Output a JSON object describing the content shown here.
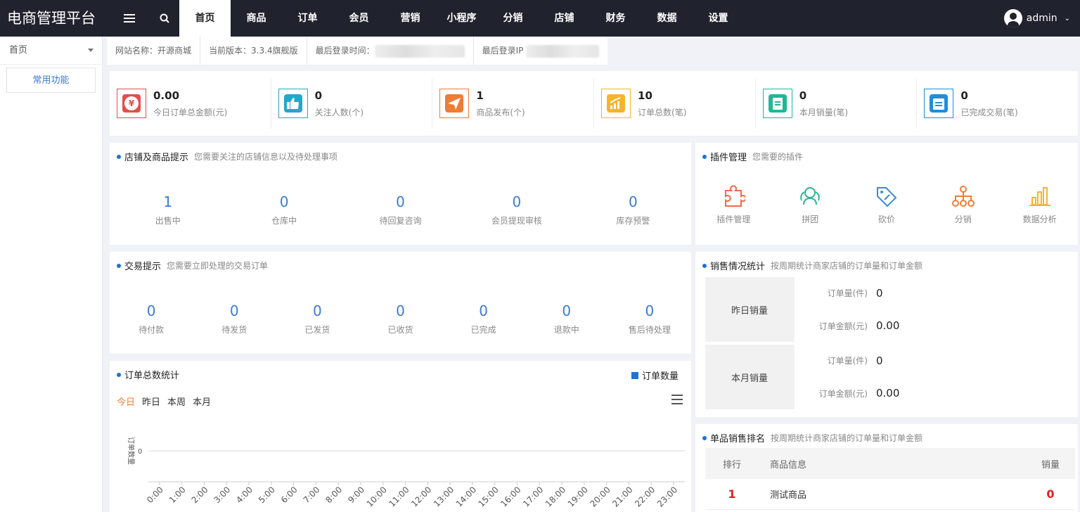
{
  "header": {
    "brand": "电商管理平台",
    "nav": [
      "首页",
      "商品",
      "订单",
      "会员",
      "营销",
      "小程序",
      "分销",
      "店铺",
      "财务",
      "数据",
      "设置"
    ],
    "active_nav": "首页",
    "user": "admin"
  },
  "sidebar": {
    "head": "首页",
    "items": [
      "常用功能"
    ]
  },
  "infobar": {
    "site_name": "网站名称：开源商城",
    "version": "当前版本：3.3.4旗舰版",
    "last_login_time": "最后登录时间：",
    "last_login_ip": "最后登录IP"
  },
  "stats": [
    {
      "value": "0.00",
      "label": "今日订单总金额(元)",
      "icon": "yen-icon",
      "color": "#e0504c"
    },
    {
      "value": "0",
      "label": "关注人数(个)",
      "icon": "thumbs-up-icon",
      "color": "#22a9c9"
    },
    {
      "value": "1",
      "label": "商品发布(个)",
      "icon": "paper-plane-icon",
      "color": "#ef7d35"
    },
    {
      "value": "10",
      "label": "订单总数(笔)",
      "icon": "chart-up-icon",
      "color": "#f5b52a"
    },
    {
      "value": "0",
      "label": "本月销量(笔)",
      "icon": "clipboard-icon",
      "color": "#1eb896"
    },
    {
      "value": "0",
      "label": "已完成交易(笔)",
      "icon": "calendar-icon",
      "color": "#1e8fd8"
    }
  ],
  "shop_panel": {
    "title": "店铺及商品提示",
    "subtitle": "您需要关注的店铺信息以及待处理事项",
    "items": [
      {
        "value": "1",
        "label": "出售中"
      },
      {
        "value": "0",
        "label": "仓库中"
      },
      {
        "value": "0",
        "label": "待回复咨询"
      },
      {
        "value": "0",
        "label": "会员提现审核"
      },
      {
        "value": "0",
        "label": "库存预警"
      }
    ]
  },
  "trade_panel": {
    "title": "交易提示",
    "subtitle": "您需要立即处理的交易订单",
    "items": [
      {
        "value": "0",
        "label": "待付款"
      },
      {
        "value": "0",
        "label": "待发货"
      },
      {
        "value": "0",
        "label": "已发货"
      },
      {
        "value": "0",
        "label": "已收货"
      },
      {
        "value": "0",
        "label": "已完成"
      },
      {
        "value": "0",
        "label": "退款中"
      },
      {
        "value": "0",
        "label": "售后待处理"
      }
    ]
  },
  "plugin_panel": {
    "title": "插件管理",
    "subtitle": "您需要的插件",
    "items": [
      {
        "label": "插件管理",
        "icon": "puzzle-icon",
        "color": "#ef6a4a"
      },
      {
        "label": "拼团",
        "icon": "group-icon",
        "color": "#2bb39a"
      },
      {
        "label": "砍价",
        "icon": "tag-icon",
        "color": "#3a8ad8"
      },
      {
        "label": "分销",
        "icon": "org-tree-icon",
        "color": "#ef7d35"
      },
      {
        "label": "数据分析",
        "icon": "bar-chart-icon",
        "color": "#f5b52a"
      }
    ]
  },
  "sales_panel": {
    "title": "销售情况统计",
    "subtitle": "按周期统计商家店铺的订单量和订单金额",
    "blocks": [
      {
        "name": "昨日销量",
        "rows": [
          {
            "k": "订单量(件)",
            "v": "0"
          },
          {
            "k": "订单金额(元)",
            "v": "0.00"
          }
        ]
      },
      {
        "name": "本月销量",
        "rows": [
          {
            "k": "订单量(件)",
            "v": "0"
          },
          {
            "k": "订单金额(元)",
            "v": "0.00"
          }
        ]
      }
    ]
  },
  "rank_panel": {
    "title": "单品销售排名",
    "subtitle": "按周期统计商家店铺的订单量和订单金额",
    "headers": [
      "排行",
      "商品信息",
      "销量"
    ],
    "rows": [
      {
        "rank": "1",
        "name": "测试商品",
        "sales": "0"
      }
    ]
  },
  "order_chart_panel": {
    "title": "订单总数统计",
    "tabs": [
      "今日",
      "昨日",
      "本周",
      "本月"
    ],
    "active_tab": "今日",
    "accent": "#ef7d35",
    "legend": "订单数量"
  },
  "chart_data": {
    "type": "bar",
    "categories": [
      "0:00",
      "1:00",
      "2:00",
      "3:00",
      "4:00",
      "5:00",
      "6:00",
      "7:00",
      "8:00",
      "9:00",
      "10:00",
      "11:00",
      "12:00",
      "13:00",
      "14:00",
      "15:00",
      "16:00",
      "17:00",
      "18:00",
      "19:00",
      "20:00",
      "21:00",
      "22:00",
      "23:00"
    ],
    "series": [
      {
        "name": "订单数量",
        "values": [
          0,
          0,
          0,
          0,
          0,
          0,
          0,
          0,
          0,
          0,
          0,
          0,
          0,
          0,
          0,
          0,
          0,
          0,
          0,
          0,
          0,
          0,
          0,
          0
        ]
      }
    ],
    "ylabel": "订单数量",
    "yticks": [
      "0"
    ],
    "color": "#1e72d8"
  }
}
